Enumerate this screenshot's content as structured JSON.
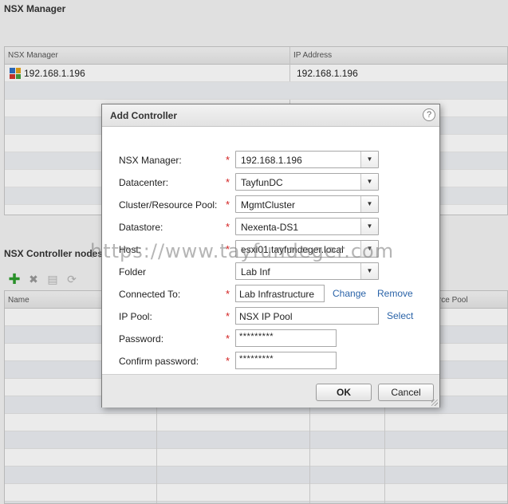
{
  "background": {
    "section_title": "NSX Manager",
    "table": {
      "columns": [
        "NSX Manager",
        "IP Address"
      ],
      "rows": [
        {
          "manager": "192.168.1.196",
          "ip": "192.168.1.196"
        }
      ]
    },
    "controller_section_title": "NSX Controller nodes",
    "controller_table": {
      "columns": [
        "Name",
        "Resource Pool"
      ]
    }
  },
  "dialog": {
    "title": "Add Controller",
    "help": "?",
    "fields": {
      "nsx_manager": {
        "label": "NSX Manager:",
        "value": "192.168.1.196"
      },
      "datacenter": {
        "label": "Datacenter:",
        "value": "TayfunDC"
      },
      "cluster": {
        "label": "Cluster/Resource Pool:",
        "value": "MgmtCluster"
      },
      "datastore": {
        "label": "Datastore:",
        "value": "Nexenta-DS1"
      },
      "host": {
        "label": "Host:",
        "value": "esxi01.tayfundeger.local"
      },
      "folder": {
        "label": "Folder",
        "value": "Lab Inf"
      },
      "connected_to": {
        "label": "Connected To:",
        "value": "Lab Infrastructure",
        "change_link": "Change",
        "remove_link": "Remove"
      },
      "ip_pool": {
        "label": "IP Pool:",
        "value": "NSX IP Pool",
        "select_link": "Select"
      },
      "password": {
        "label": "Password:",
        "value": "*********"
      },
      "confirm_password": {
        "label": "Confirm password:",
        "value": "*********"
      }
    },
    "required_marker": "*",
    "dropdown_arrow": "▼",
    "buttons": {
      "ok": "OK",
      "cancel": "Cancel"
    }
  },
  "watermark": "https://www.tayfundeger.com",
  "colors": {
    "link": "#2a63a8",
    "required": "#d32020",
    "add_icon": "#2d9d2d"
  },
  "icons": [
    "nsx-manager-icon",
    "add-icon",
    "delete-icon",
    "edit-icon",
    "refresh-icon",
    "help-icon",
    "dropdown-arrow-icon"
  ]
}
